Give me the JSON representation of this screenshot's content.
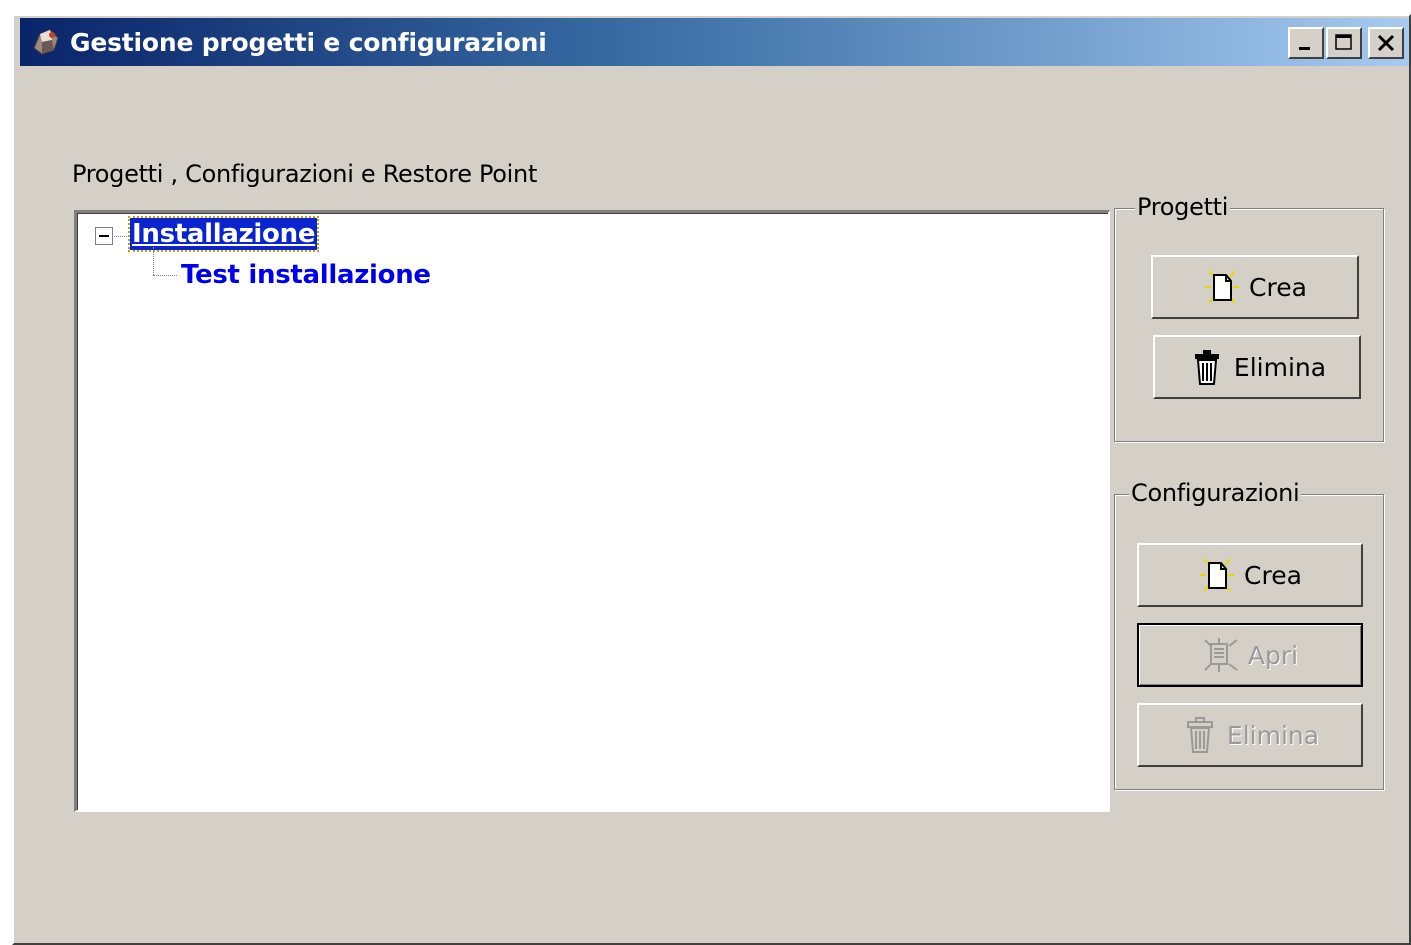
{
  "window": {
    "title": "Gestione progetti e configurazioni",
    "controls": {
      "minimize": "_",
      "maximize": "□",
      "close": "X"
    }
  },
  "tree_section": {
    "label": "Progetti , Configurazioni e Restore Point",
    "nodes": [
      {
        "label": "Installazione",
        "expanded": true,
        "selected": true,
        "children": [
          {
            "label": "Test installazione"
          }
        ]
      }
    ]
  },
  "progetti": {
    "label": "Progetti",
    "crea": "Crea",
    "elimina": "Elimina"
  },
  "configurazioni": {
    "label": "Configurazioni",
    "crea": "Crea",
    "apri": "Apri",
    "elimina": "Elimina"
  },
  "icons": {
    "app": "app-icon",
    "new": "new-document-icon",
    "delete": "trash-icon",
    "open": "open-config-icon"
  },
  "colors": {
    "title_start": "#0a246a",
    "title_end": "#a6caf0",
    "face": "#d4d0c8",
    "tree_link": "#0000f0",
    "selection": "#0a24d0"
  }
}
